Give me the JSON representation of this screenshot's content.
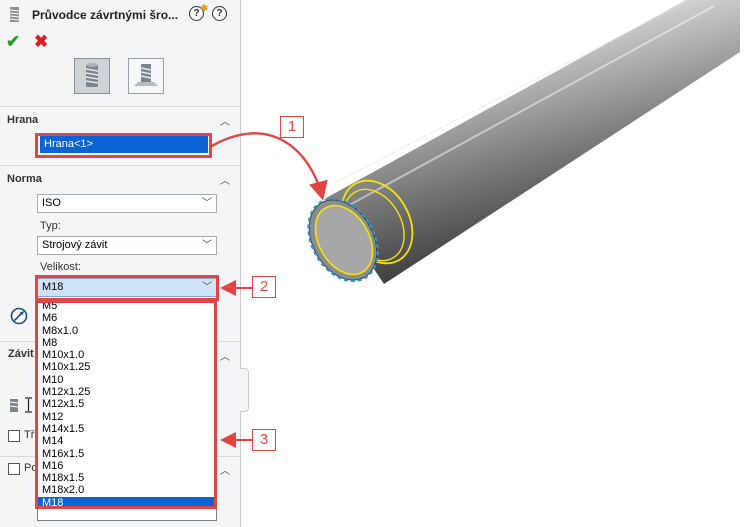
{
  "panel": {
    "title": "Průvodce závrtnými šro...",
    "help_glyph": "?",
    "edge_section": {
      "title": "Hrana",
      "edge_value": "Hrana<1>"
    },
    "standard_section": {
      "title": "Norma",
      "standard_value": "ISO",
      "type_label": "Typ:",
      "type_value": "Strojový závit",
      "size_label": "Velikost:",
      "size_value": "M18"
    },
    "thread_section": {
      "title_fragment": "Závit"
    },
    "checkbox_partial_1": "Tří",
    "checkbox_partial_2": "Po"
  },
  "size_options": [
    "M5",
    "M6",
    "M8x1.0",
    "M8",
    "M10x1.0",
    "M10x1.25",
    "M10",
    "M12x1.25",
    "M12x1.5",
    "M12",
    "M14x1.5",
    "M14",
    "M16x1.5",
    "M16",
    "M18x1.5",
    "M18x2.0",
    "M18"
  ],
  "callouts": {
    "one": "1",
    "two": "2",
    "three": "3"
  },
  "colors": {
    "accent": "#0a64d6",
    "annotation_red": "#e34545",
    "edge_highlight": "#f2e40c",
    "selected_circle": "#2d9ad6"
  }
}
